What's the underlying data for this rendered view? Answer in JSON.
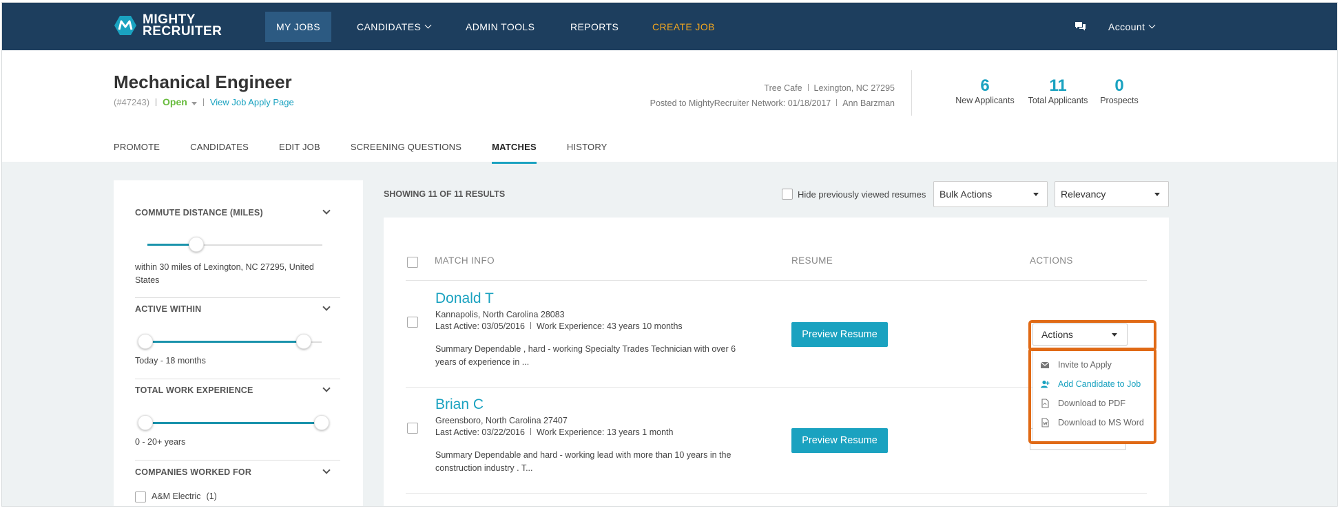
{
  "nav": {
    "logo_line1": "MIGHTY",
    "logo_line2": "RECRUITER",
    "items": [
      {
        "label": "MY JOBS"
      },
      {
        "label": "CANDIDATES"
      },
      {
        "label": "ADMIN TOOLS"
      },
      {
        "label": "REPORTS"
      },
      {
        "label": "CREATE JOB"
      }
    ],
    "account_label": "Account",
    "chat_icon": "chat-bubbles-icon"
  },
  "job": {
    "title": "Mechanical Engineer",
    "id": "(#47243)",
    "status": "Open",
    "apply_link": "View Job Apply Page",
    "company": "Tree Cafe",
    "location": "Lexington, NC 27295",
    "posted": "Posted to MightyRecruiter Network: 01/18/2017",
    "poster": "Ann Barzman"
  },
  "stats": [
    {
      "value": "6",
      "label": "New Applicants"
    },
    {
      "value": "11",
      "label": "Total Applicants"
    },
    {
      "value": "0",
      "label": "Prospects"
    }
  ],
  "tabs": [
    "PROMOTE",
    "CANDIDATES",
    "EDIT JOB",
    "SCREENING QUESTIONS",
    "MATCHES",
    "HISTORY"
  ],
  "filters": {
    "commute": {
      "title": "COMMUTE DISTANCE (MILES)",
      "text": "within 30 miles of Lexington, NC 27295, United States",
      "value_fraction": 0.28
    },
    "active": {
      "title": "ACTIVE WITHIN",
      "text": "Today - 18 months",
      "min_fraction": 0.0,
      "max_fraction": 0.9
    },
    "experience": {
      "title": "TOTAL WORK EXPERIENCE",
      "text": "0 - 20+ years",
      "min_fraction": 0.0,
      "max_fraction": 1.0
    },
    "companies": {
      "title": "COMPANIES WORKED FOR",
      "first_option": "A&M Electric",
      "first_count": "(1)"
    }
  },
  "results": {
    "showing": "SHOWING 11 OF 11 RESULTS",
    "hide_viewed": "Hide previously viewed resumes",
    "bulk_actions": "Bulk Actions",
    "sort": "Relevancy",
    "col_match": "MATCH INFO",
    "col_resume": "RESUME",
    "col_actions": "ACTIONS",
    "preview_label": "Preview Resume",
    "actions_label": "Actions",
    "candidates": [
      {
        "name": "Donald T",
        "location": "Kannapolis, North Carolina 28083",
        "last_active": "Last Active: 03/05/2016",
        "experience": "Work Experience: 43 years 10 months",
        "summary": "Summary Dependable , hard - working Specialty Trades Technician with over 6 years of experience in ..."
      },
      {
        "name": "Brian C",
        "location": "Greensboro, North Carolina 27407",
        "last_active": "Last Active: 03/22/2016",
        "experience": "Work Experience: 13 years 1 month",
        "summary": "Summary Dependable and hard - working lead with more than 10 years in the construction industry . T..."
      }
    ]
  },
  "action_menu": [
    {
      "label": "Invite to Apply",
      "icon": "envelope-icon"
    },
    {
      "label": "Add Candidate to Job",
      "icon": "add-user-icon"
    },
    {
      "label": "Download to PDF",
      "icon": "pdf-file-icon"
    },
    {
      "label": "Download to MS Word",
      "icon": "word-file-icon"
    }
  ],
  "colors": {
    "nav_bg": "#1d3e5e",
    "accent": "#1aa2c0",
    "create_job": "#f2a61f",
    "open_status": "#67bb3c",
    "highlight": "#e06a16"
  }
}
